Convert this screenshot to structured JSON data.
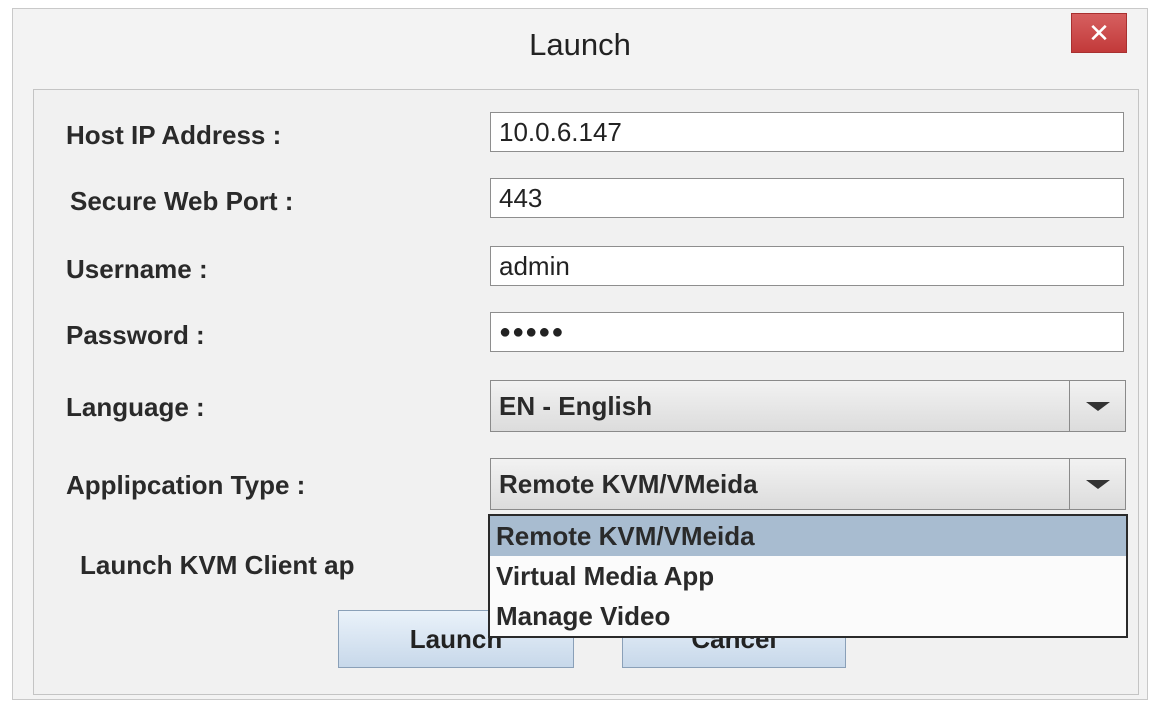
{
  "window": {
    "title": "Launch",
    "close_glyph": "✕"
  },
  "form": {
    "host_ip_label": "Host IP Address :",
    "host_ip_value": "10.0.6.147",
    "port_label": "Secure Web Port :",
    "port_value": "443",
    "username_label": "Username :",
    "username_value": "admin",
    "password_label": "Password :",
    "password_mask": "●●●●●",
    "language_label": "Language :",
    "language_value": "EN - English",
    "app_type_label": "Applipcation Type :",
    "app_type_value": "Remote KVM/VMeida",
    "launch_note": "Launch KVM Client ap"
  },
  "dropdown": {
    "options": [
      "Remote KVM/VMeida",
      "Virtual Media App",
      "Manage Video"
    ],
    "highlighted_index": 0
  },
  "buttons": {
    "launch_label": "Launch",
    "cancel_label": "Cancel"
  },
  "icons": {
    "close": "close-icon",
    "combo_arrow": "chevron-down-icon"
  },
  "colors": {
    "close_button": "#c94545",
    "selected_option": "#a8bcd0",
    "button_gradient_top": "#eaf2fa",
    "button_gradient_bottom": "#c7d8ea"
  }
}
